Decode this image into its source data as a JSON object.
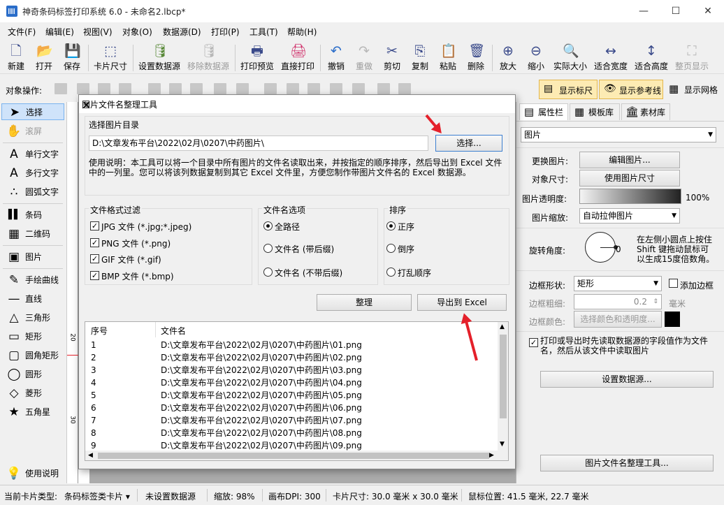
{
  "window": {
    "title": "神奇条码标签打印系统 6.0 - 未命名2.lbcp*",
    "minimize": "—",
    "maximize": "☐",
    "close": "✕"
  },
  "menu": [
    "文件(F)",
    "编辑(E)",
    "视图(V)",
    "对象(O)",
    "数据源(D)",
    "打印(P)",
    "工具(T)",
    "帮助(H)"
  ],
  "toolbar": [
    {
      "label": "新建",
      "icon": "new-file-icon",
      "glyph": "🗋"
    },
    {
      "label": "打开",
      "icon": "open-icon",
      "glyph": "📂"
    },
    {
      "label": "保存",
      "icon": "save-icon",
      "glyph": "💾"
    },
    {
      "label": "卡片尺寸",
      "icon": "card-size-icon",
      "glyph": "⬚"
    },
    {
      "label": "设置数据源",
      "icon": "database-icon",
      "glyph": "🛢"
    },
    {
      "label": "移除数据源",
      "icon": "remove-database-icon",
      "glyph": "🛢"
    },
    {
      "label": "打印预览",
      "icon": "print-preview-icon",
      "glyph": "🖶"
    },
    {
      "label": "直接打印",
      "icon": "printer-icon",
      "glyph": "🖨"
    },
    {
      "label": "撤销",
      "icon": "undo-icon",
      "glyph": "↶"
    },
    {
      "label": "重做",
      "icon": "redo-icon",
      "glyph": "↷"
    },
    {
      "label": "剪切",
      "icon": "cut-icon",
      "glyph": "✂"
    },
    {
      "label": "复制",
      "icon": "copy-icon",
      "glyph": "⎘"
    },
    {
      "label": "粘贴",
      "icon": "paste-icon",
      "glyph": "📋"
    },
    {
      "label": "删除",
      "icon": "trash-icon",
      "glyph": "🗑"
    },
    {
      "label": "放大",
      "icon": "zoom-in-icon",
      "glyph": "⊕"
    },
    {
      "label": "缩小",
      "icon": "zoom-out-icon",
      "glyph": "⊖"
    },
    {
      "label": "实际大小",
      "icon": "actual-size-icon",
      "glyph": "🔍"
    },
    {
      "label": "适合宽度",
      "icon": "fit-width-icon",
      "glyph": "↔"
    },
    {
      "label": "适合高度",
      "icon": "fit-height-icon",
      "glyph": "↕"
    },
    {
      "label": "整页显示",
      "icon": "fit-page-icon",
      "glyph": "⛶"
    }
  ],
  "objbar": {
    "label": "对象操作:",
    "show_ruler": "显示标尺",
    "show_guides": "显示参考线",
    "show_grid": "显示网格"
  },
  "sidebar": [
    {
      "label": "选择",
      "icon": "cursor-icon",
      "glyph": "➤"
    },
    {
      "label": "滚屏",
      "icon": "hand-icon",
      "glyph": "✋"
    },
    {
      "label": "单行文字",
      "icon": "text-icon",
      "glyph": "A"
    },
    {
      "label": "多行文字",
      "icon": "multiline-text-icon",
      "glyph": "A"
    },
    {
      "label": "圆弧文字",
      "icon": "arc-text-icon",
      "glyph": "∴"
    },
    {
      "label": "条码",
      "icon": "barcode-icon",
      "glyph": "▌▌"
    },
    {
      "label": "二维码",
      "icon": "qrcode-icon",
      "glyph": "▦"
    },
    {
      "label": "图片",
      "icon": "image-icon",
      "glyph": "▣"
    },
    {
      "label": "手绘曲线",
      "icon": "pen-icon",
      "glyph": "✎"
    },
    {
      "label": "直线",
      "icon": "line-icon",
      "glyph": "—"
    },
    {
      "label": "三角形",
      "icon": "triangle-icon",
      "glyph": "△"
    },
    {
      "label": "矩形",
      "icon": "rectangle-icon",
      "glyph": "▭"
    },
    {
      "label": "圆角矩形",
      "icon": "rounded-rect-icon",
      "glyph": "▢"
    },
    {
      "label": "圆形",
      "icon": "circle-icon",
      "glyph": "◯"
    },
    {
      "label": "菱形",
      "icon": "diamond-icon",
      "glyph": "◇"
    },
    {
      "label": "五角星",
      "icon": "star-icon",
      "glyph": "★"
    },
    {
      "label": "使用说明",
      "icon": "lightbulb-icon",
      "glyph": "💡"
    }
  ],
  "ruler": {
    "mark20": "20",
    "mark30": "30"
  },
  "rpanel": {
    "tabs": [
      "属性栏",
      "模板库",
      "素材库"
    ],
    "object_type": "图片",
    "change_image": "更换图片:",
    "edit_image_btn": "编辑图片...",
    "object_size": "对象尺寸:",
    "use_image_size_btn": "使用图片尺寸",
    "opacity_label": "图片透明度:",
    "opacity_value": "100%",
    "scale_label": "图片缩放:",
    "scale_value": "自动拉伸图片",
    "rotation_label": "旋转角度:",
    "rotation_value": "0",
    "rotation_hint": "在左侧小圆点上按住Shift 键拖动鼠标可以生成15度倍数角。",
    "border_shape_label": "边框形状:",
    "border_shape_value": "矩形",
    "add_border": "添加边框",
    "border_width_label": "边框粗细:",
    "border_width_value": "0.2",
    "border_width_unit": "毫米",
    "border_color_label": "边框颜色:",
    "border_color_btn": "选择颜色和透明度...",
    "read_path_text": "打印或导出时先读取数据源的字段值作为文件名，然后从该文件中读取图片",
    "set_datasource_btn": "设置数据源...",
    "image_tool_btn": "图片文件名整理工具..."
  },
  "dialog": {
    "title": "图片文件名整理工具",
    "dir_group": "选择图片目录",
    "dir_value": "D:\\文章发布平台\\2022\\02月\\0207\\中药图片\\",
    "choose_btn": "选择...",
    "help_text": "使用说明：本工具可以将一个目录中所有图片的文件名读取出来，并按指定的顺序排序，然后导出到 Excel 文件中的一列里。您可以将该列数据复制到其它 Excel 文件里，方便您制作带图片文件名的 Excel 数据源。",
    "format_group": "文件格式过滤",
    "formats": [
      "JPG 文件 (*.jpg;*.jpeg)",
      "PNG 文件 (*.png)",
      "GIF 文件 (*.gif)",
      "BMP 文件 (*.bmp)"
    ],
    "name_group": "文件名选项",
    "name_options": [
      "全路径",
      "文件名 (带后缀)",
      "文件名 (不带后缀)"
    ],
    "sort_group": "排序",
    "sort_options": [
      "正序",
      "倒序",
      "打乱顺序"
    ],
    "organize_btn": "整理",
    "export_btn": "导出到 Excel",
    "columns": [
      "序号",
      "文件名"
    ],
    "rows": [
      [
        "1",
        "D:\\文章发布平台\\2022\\02月\\0207\\中药图片\\01.png"
      ],
      [
        "2",
        "D:\\文章发布平台\\2022\\02月\\0207\\中药图片\\02.png"
      ],
      [
        "3",
        "D:\\文章发布平台\\2022\\02月\\0207\\中药图片\\03.png"
      ],
      [
        "4",
        "D:\\文章发布平台\\2022\\02月\\0207\\中药图片\\04.png"
      ],
      [
        "5",
        "D:\\文章发布平台\\2022\\02月\\0207\\中药图片\\05.png"
      ],
      [
        "6",
        "D:\\文章发布平台\\2022\\02月\\0207\\中药图片\\06.png"
      ],
      [
        "7",
        "D:\\文章发布平台\\2022\\02月\\0207\\中药图片\\07.png"
      ],
      [
        "8",
        "D:\\文章发布平台\\2022\\02月\\0207\\中药图片\\08.png"
      ],
      [
        "9",
        "D:\\文章发布平台\\2022\\02月\\0207\\中药图片\\09.png"
      ]
    ]
  },
  "status": {
    "card_type": "当前卡片类型:",
    "card_value": "条码标签类卡片",
    "datasource": "未设置数据源",
    "zoom": "缩放: 98%",
    "dpi": "画布DPI: 300",
    "card_size": "卡片尺寸: 30.0 毫米 x 30.0 毫米",
    "mouse_pos": "鼠标位置: 41.5 毫米, 22.7 毫米"
  },
  "colors": {
    "accent": "#2a6dc9",
    "arrow": "#e4202a",
    "selected": "#cfe3fa"
  }
}
